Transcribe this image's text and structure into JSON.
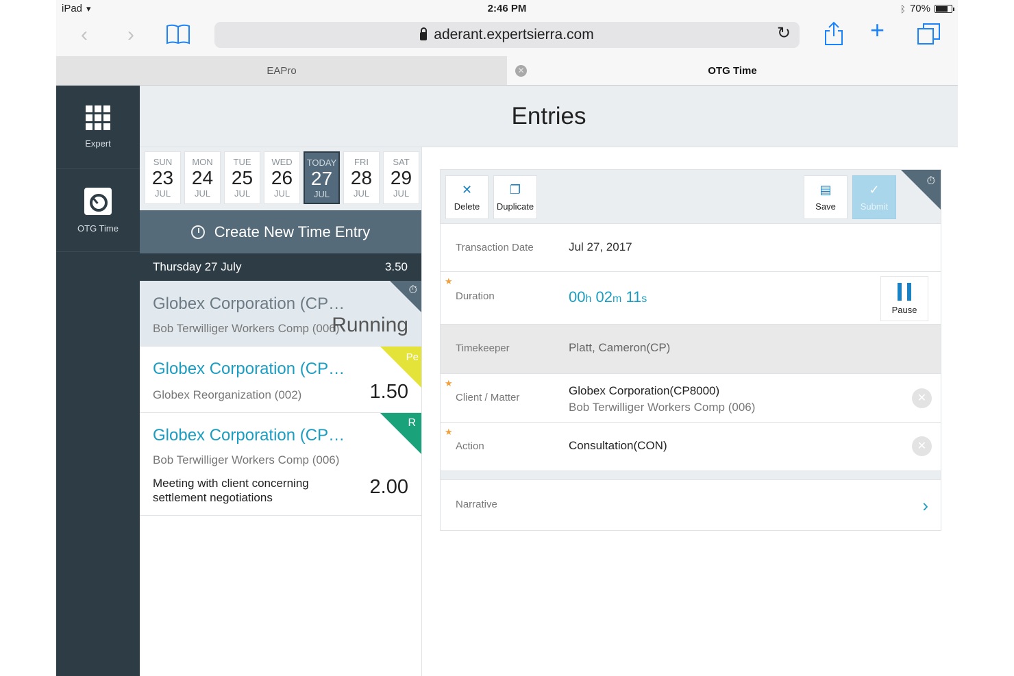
{
  "status_bar": {
    "device": "iPad",
    "time": "2:46 PM",
    "battery": "70%"
  },
  "browser": {
    "url": "aderant.expertsierra.com"
  },
  "tabs": [
    {
      "label": "EAPro"
    },
    {
      "label": "OTG Time"
    }
  ],
  "sidebar": {
    "items": [
      {
        "label": "Expert"
      },
      {
        "label": "OTG Time"
      }
    ]
  },
  "header": {
    "title": "Entries"
  },
  "week": [
    {
      "dow": "SUN",
      "num": "23",
      "mon": "JUL"
    },
    {
      "dow": "MON",
      "num": "24",
      "mon": "JUL"
    },
    {
      "dow": "TUE",
      "num": "25",
      "mon": "JUL"
    },
    {
      "dow": "WED",
      "num": "26",
      "mon": "JUL"
    },
    {
      "dow": "TODAY",
      "num": "27",
      "mon": "JUL"
    },
    {
      "dow": "FRI",
      "num": "28",
      "mon": "JUL"
    },
    {
      "dow": "SAT",
      "num": "29",
      "mon": "JUL"
    }
  ],
  "create_entry": {
    "label": "Create New Time Entry"
  },
  "day_header": {
    "label": "Thursday  27 July",
    "total": "3.50"
  },
  "entries": [
    {
      "client": "Globex Corporation (CP…",
      "matter": "Bob Terwilliger Workers Comp (006)",
      "status": "Running"
    },
    {
      "client": "Globex Corporation (CP…",
      "matter": "Globex Reorganization (002)",
      "badge": "Pe",
      "hours": "1.50"
    },
    {
      "client": "Globex Corporation (CP…",
      "matter": "Bob Terwilliger Workers Comp (006)",
      "narrative": "Meeting with client concerning settlement negotiations",
      "badge": "R",
      "hours": "2.00"
    }
  ],
  "toolbar": {
    "delete": "Delete",
    "duplicate": "Duplicate",
    "save": "Save",
    "submit": "Submit"
  },
  "form": {
    "transaction_date": {
      "label": "Transaction Date",
      "value": "Jul 27, 2017"
    },
    "duration": {
      "label": "Duration",
      "h": "00",
      "h_unit": "h",
      "m": "02",
      "m_unit": "m",
      "s": "11",
      "s_unit": "s",
      "pause": "Pause"
    },
    "timekeeper": {
      "label": "Timekeeper",
      "value": "Platt, Cameron(CP)"
    },
    "client_matter": {
      "label": "Client / Matter",
      "client": "Globex Corporation(CP8000)",
      "matter": "Bob Terwilliger Workers Comp (006)"
    },
    "action": {
      "label": "Action",
      "value": "Consultation(CON)"
    },
    "narrative": {
      "label": "Narrative"
    }
  },
  "colors": {
    "sidebar_bg": "#2e3c46",
    "accent_blue": "#1a9dc1",
    "badge_yellow": "#e3e33a",
    "badge_green": "#1aa37a",
    "submit_disabled": "#a9d6ea"
  }
}
